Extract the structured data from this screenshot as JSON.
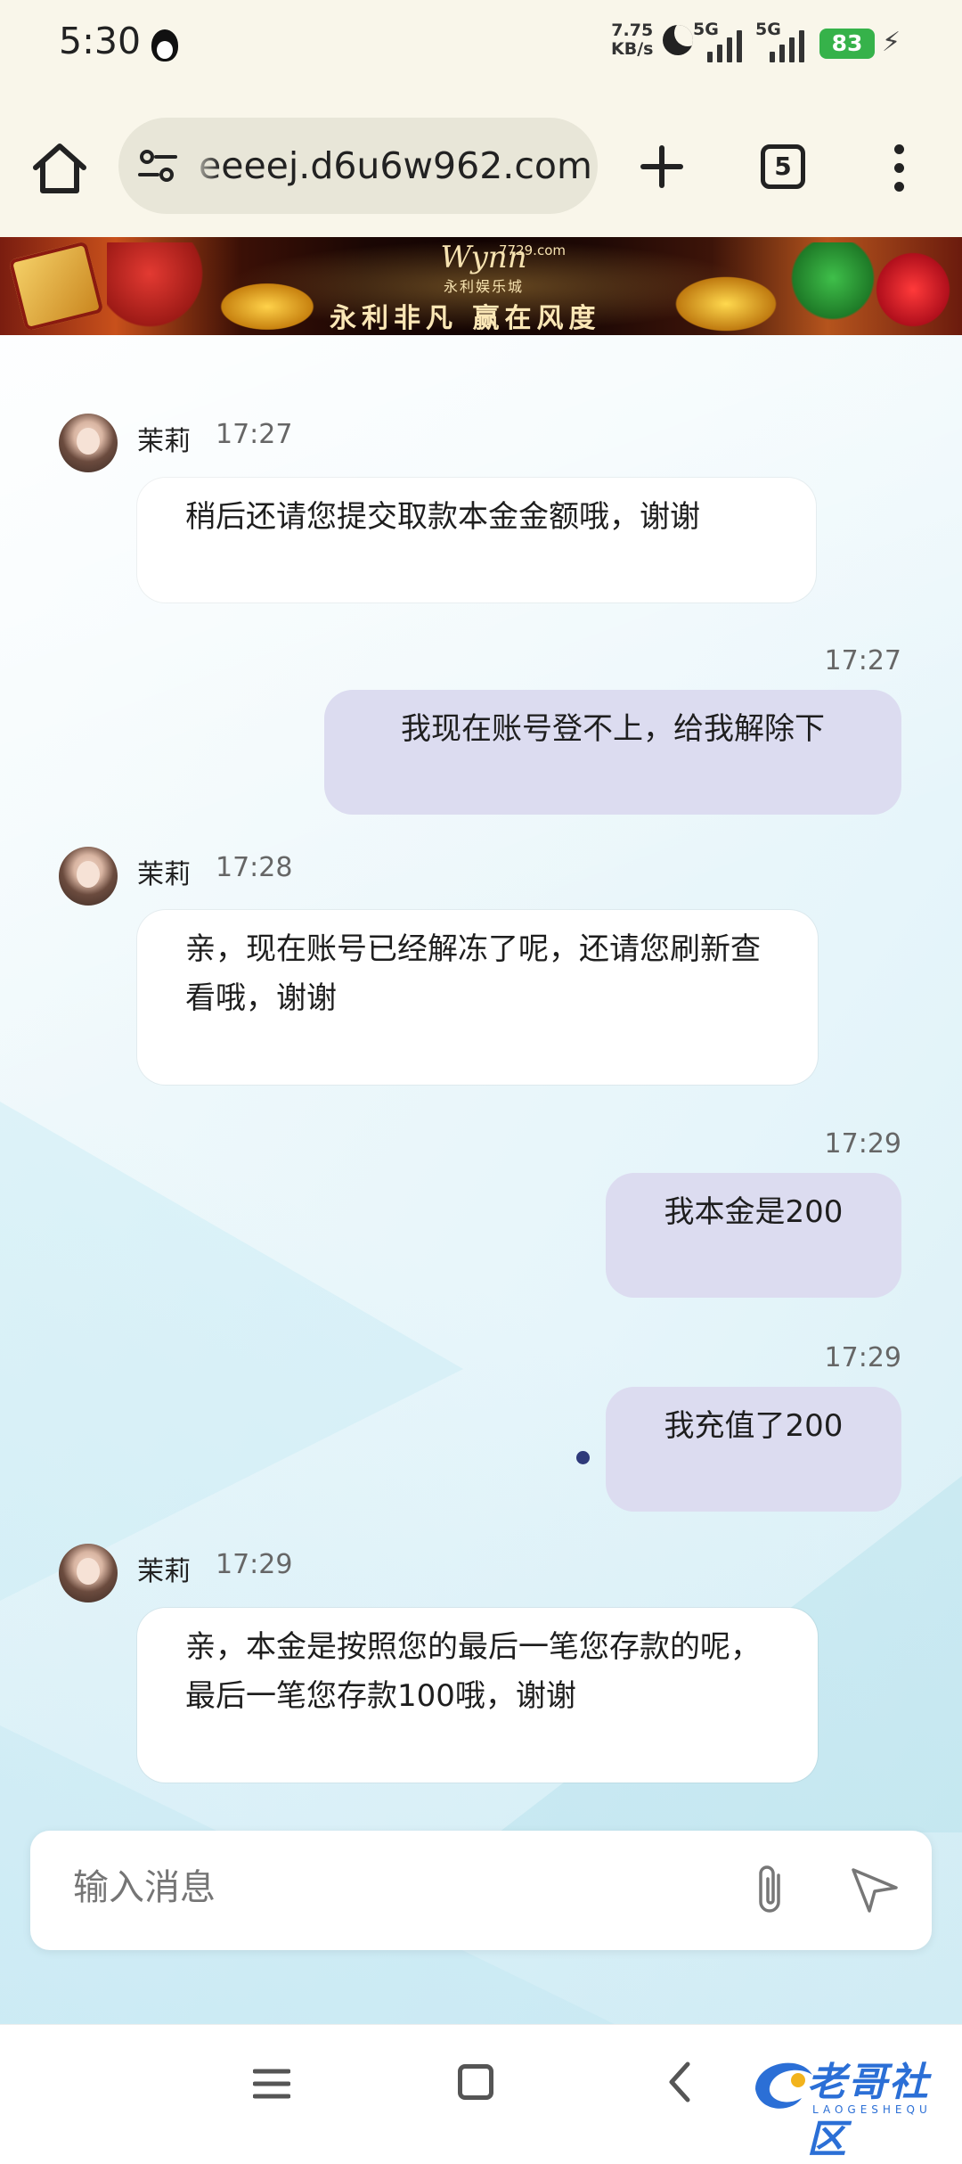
{
  "status_bar": {
    "time": "5:30",
    "net_speed_value": "7.75",
    "net_speed_unit": "KB/s",
    "network_1": "5G",
    "network_2": "5G",
    "battery": "83",
    "icons": [
      "qq-icon",
      "moon-icon",
      "signal-icon",
      "signal-icon",
      "battery-icon",
      "charging-icon"
    ]
  },
  "browser": {
    "url": "eeeej.d6u6w962.com",
    "tab_count": "5",
    "icons": [
      "home-icon",
      "site-settings-icon",
      "plus-icon",
      "tabs-icon",
      "more-menu-icon"
    ]
  },
  "banner": {
    "brand": "Wynn",
    "site": "7729.com",
    "brand_sub": "永利娱乐城",
    "slogan": "永利非凡  赢在风度"
  },
  "messages": [
    {
      "side": "in",
      "sender": "茉莉",
      "time": "17:27",
      "text": "稍后还请您提交取款本金金额哦，谢谢"
    },
    {
      "side": "out",
      "time": "17:27",
      "text": "我现在账号登不上，给我解除下"
    },
    {
      "side": "in",
      "sender": "茉莉",
      "time": "17:28",
      "text": "亲，现在账号已经解冻了呢，还请您刷新查看哦，谢谢"
    },
    {
      "side": "out",
      "time": "17:29",
      "text": "我本金是200"
    },
    {
      "side": "out",
      "time": "17:29",
      "text": "我充值了200"
    },
    {
      "side": "in",
      "sender": "茉莉",
      "time": "17:29",
      "text": "亲，本金是按照您的最后一笔您存款的呢，最后一笔您存款100哦，谢谢"
    }
  ],
  "composer": {
    "placeholder": "输入消息",
    "icons": [
      "paperclip-icon",
      "send-icon"
    ]
  },
  "nav": {
    "icons": [
      "menu-icon",
      "home-square-icon",
      "back-icon"
    ],
    "watermark": "老哥社区",
    "watermark_sub": "LAOGESHEQU"
  },
  "colors": {
    "battery_green": "#36b24a",
    "outgoing_bubble": "#dcdcf0",
    "incoming_bubble": "#ffffff",
    "watermark_blue": "#2b6fd6"
  }
}
